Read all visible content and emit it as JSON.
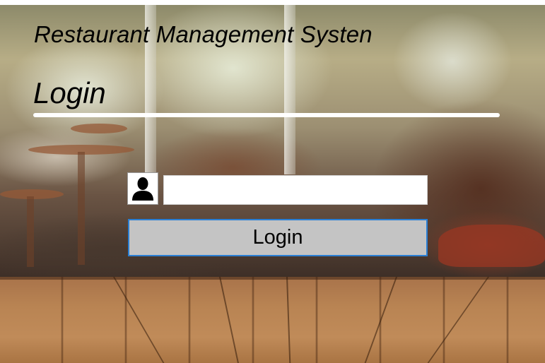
{
  "app": {
    "title": "Restaurant Management Systen",
    "heading": "Login"
  },
  "form": {
    "user_icon": "user-silhouette-icon",
    "username_value": "",
    "login_label": "Login"
  },
  "colors": {
    "button_bg": "#c4c4c4",
    "button_border": "#2a7fd4",
    "rule": "#ffffff"
  }
}
